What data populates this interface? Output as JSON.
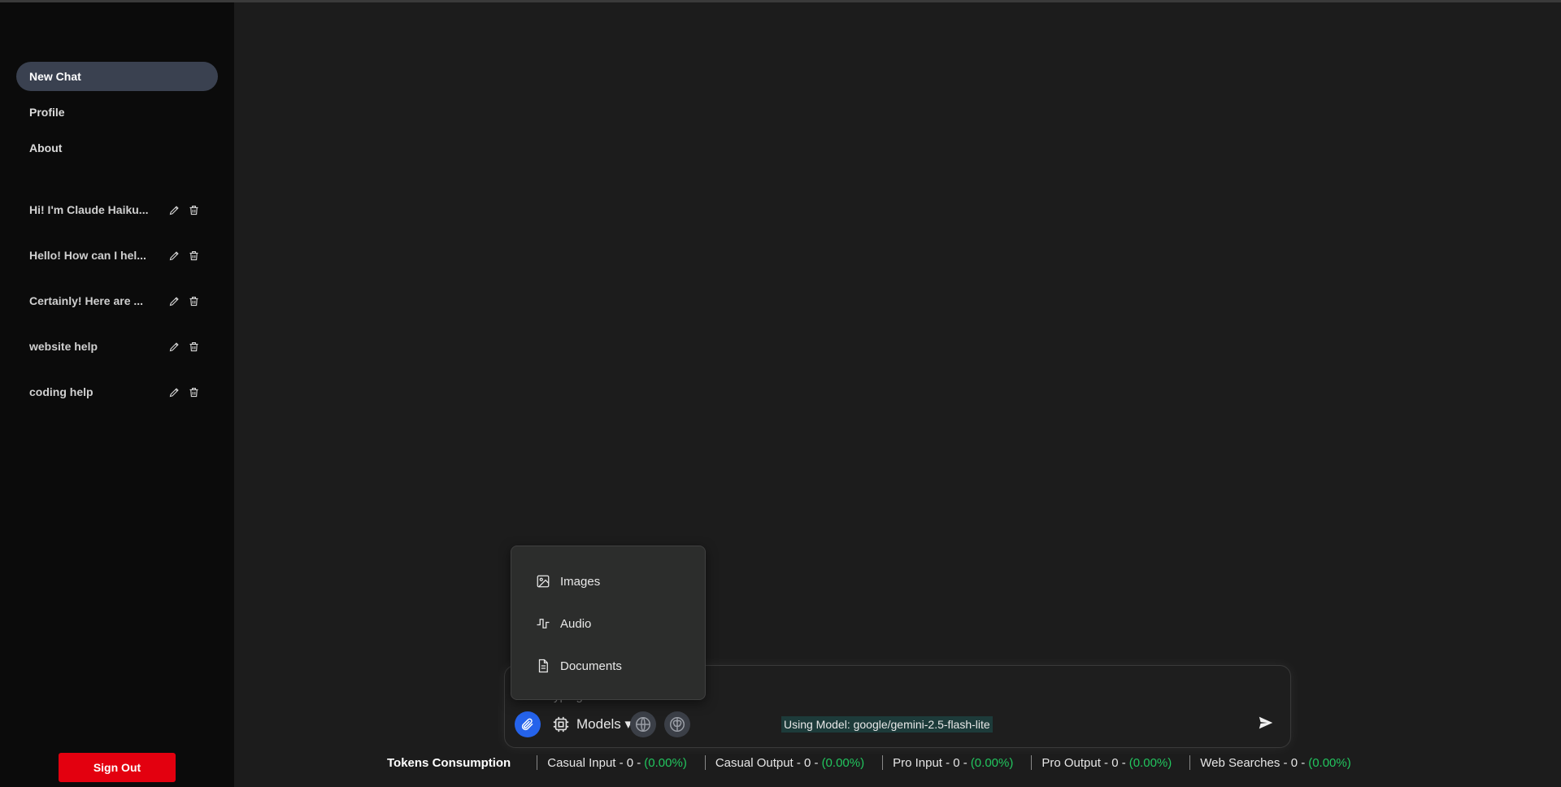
{
  "sidebar": {
    "nav": [
      {
        "label": "New Chat"
      },
      {
        "label": "Profile"
      },
      {
        "label": "About"
      }
    ],
    "chats": [
      {
        "title": "Hi! I'm Claude Haiku..."
      },
      {
        "title": "Hello! How can I hel..."
      },
      {
        "title": "Certainly! Here are ..."
      },
      {
        "title": "website help"
      },
      {
        "title": "coding help"
      }
    ],
    "sign_out": "Sign Out"
  },
  "composer": {
    "placeholder": "Start typing...",
    "models_label": "Models ▾",
    "using_model": "Using Model: google/gemini-2.5-flash-lite"
  },
  "attach_menu": {
    "items": [
      {
        "label": "Images",
        "icon": "image-icon"
      },
      {
        "label": "Audio",
        "icon": "audio-wave-icon"
      },
      {
        "label": "Documents",
        "icon": "document-icon"
      }
    ]
  },
  "tokens": {
    "title": "Tokens Consumption",
    "items": [
      {
        "label": "Casual Input - 0 - ",
        "pct": "(0.00%)"
      },
      {
        "label": "Casual Output - 0 - ",
        "pct": "(0.00%)"
      },
      {
        "label": "Pro Input - 0 - ",
        "pct": "(0.00%)"
      },
      {
        "label": "Pro Output - 0 - ",
        "pct": "(0.00%)"
      },
      {
        "label": "Web Searches - 0 - ",
        "pct": "(0.00%)"
      }
    ]
  },
  "colors": {
    "accent_blue": "#2563eb",
    "sign_out_red": "#e3000f",
    "pct_green": "#22c55e",
    "active_nav": "#3a4150"
  }
}
